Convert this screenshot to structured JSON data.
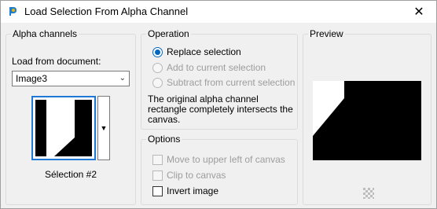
{
  "window": {
    "title": "Load Selection From Alpha Channel",
    "close_glyph": "✕",
    "icon": "app-icon"
  },
  "alpha_channels": {
    "group_label": "Alpha channels",
    "load_from_label": "Load from document:",
    "document_value": "Image3",
    "selection_caption": "Sélection #2"
  },
  "operation": {
    "group_label": "Operation",
    "options": [
      {
        "label": "Replace selection",
        "selected": true,
        "enabled": true
      },
      {
        "label": "Add to current selection",
        "selected": false,
        "enabled": false
      },
      {
        "label": "Subtract from current selection",
        "selected": false,
        "enabled": false
      }
    ],
    "description": "The original alpha channel rectangle completely intersects the canvas."
  },
  "options": {
    "group_label": "Options",
    "items": [
      {
        "label": "Move to upper left of canvas",
        "checked": false,
        "enabled": false
      },
      {
        "label": "Clip to canvas",
        "checked": false,
        "enabled": false
      },
      {
        "label": "Invert image",
        "checked": false,
        "enabled": true
      }
    ]
  },
  "preview": {
    "group_label": "Preview",
    "toggle_icon": "checkerboard-icon"
  },
  "colors": {
    "accent": "#0067c0",
    "thumb_border": "#1e78d6"
  }
}
